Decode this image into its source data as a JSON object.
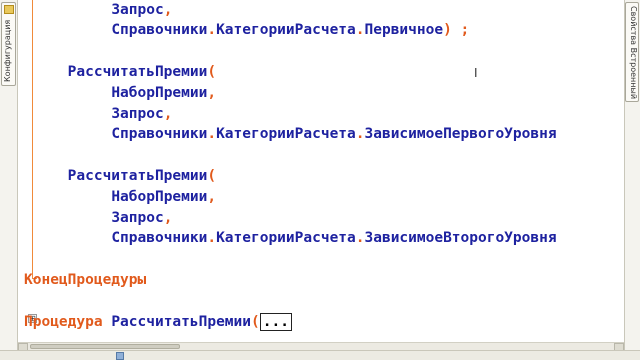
{
  "left_panel": {
    "tab_label": "Конфигурация",
    "tab_icon": "configuration-icon"
  },
  "right_panel": {
    "tab_label": "Свойства Встроенный язык"
  },
  "code": {
    "lines": [
      {
        "indent": "          ",
        "tokens": [
          {
            "t": "Запрос",
            "c": "id"
          },
          {
            "t": ",",
            "c": "op"
          }
        ]
      },
      {
        "indent": "          ",
        "tokens": [
          {
            "t": "Справочники",
            "c": "id"
          },
          {
            "t": ".",
            "c": "op"
          },
          {
            "t": "КатегорииРасчета",
            "c": "id"
          },
          {
            "t": ".",
            "c": "op"
          },
          {
            "t": "Первичное",
            "c": "id"
          },
          {
            "t": ")",
            "c": "op"
          },
          {
            "t": " ;",
            "c": "op"
          }
        ]
      },
      {
        "indent": "",
        "tokens": []
      },
      {
        "indent": "     ",
        "tokens": [
          {
            "t": "РассчитатьПремии",
            "c": "id"
          },
          {
            "t": "(",
            "c": "op"
          }
        ]
      },
      {
        "indent": "          ",
        "tokens": [
          {
            "t": "НаборПремии",
            "c": "id"
          },
          {
            "t": ",",
            "c": "op"
          }
        ]
      },
      {
        "indent": "          ",
        "tokens": [
          {
            "t": "Запрос",
            "c": "id"
          },
          {
            "t": ",",
            "c": "op"
          }
        ]
      },
      {
        "indent": "          ",
        "tokens": [
          {
            "t": "Справочники",
            "c": "id"
          },
          {
            "t": ".",
            "c": "op"
          },
          {
            "t": "КатегорииРасчета",
            "c": "id"
          },
          {
            "t": ".",
            "c": "op"
          },
          {
            "t": "ЗависимоеПервогоУровня",
            "c": "id"
          }
        ]
      },
      {
        "indent": "",
        "tokens": []
      },
      {
        "indent": "     ",
        "tokens": [
          {
            "t": "РассчитатьПремии",
            "c": "id"
          },
          {
            "t": "(",
            "c": "op"
          }
        ]
      },
      {
        "indent": "          ",
        "tokens": [
          {
            "t": "НаборПремии",
            "c": "id"
          },
          {
            "t": ",",
            "c": "op"
          }
        ]
      },
      {
        "indent": "          ",
        "tokens": [
          {
            "t": "Запрос",
            "c": "id"
          },
          {
            "t": ",",
            "c": "op"
          }
        ]
      },
      {
        "indent": "          ",
        "tokens": [
          {
            "t": "Справочники",
            "c": "id"
          },
          {
            "t": ".",
            "c": "op"
          },
          {
            "t": "КатегорииРасчета",
            "c": "id"
          },
          {
            "t": ".",
            "c": "op"
          },
          {
            "t": "ЗависимоеВторогоУровня",
            "c": "id"
          }
        ]
      },
      {
        "indent": "",
        "tokens": []
      },
      {
        "indent": "",
        "tokens": [
          {
            "t": "КонецПроцедуры",
            "c": "kw"
          }
        ]
      },
      {
        "indent": "",
        "tokens": []
      },
      {
        "indent": "",
        "tokens": [
          {
            "t": "Процедура",
            "c": "kw"
          },
          {
            "t": " ",
            "c": "op"
          },
          {
            "t": "РассчитатьПремии",
            "c": "id"
          },
          {
            "t": "(",
            "c": "op"
          }
        ]
      }
    ],
    "collapsed_marker": "...",
    "fold_marker": "⊞"
  }
}
